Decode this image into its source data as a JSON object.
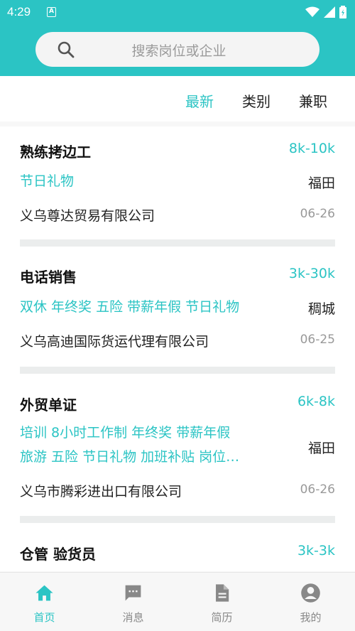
{
  "status_bar": {
    "time": "4:29",
    "notification": "A"
  },
  "search": {
    "placeholder": "搜索岗位或企业"
  },
  "filters": [
    {
      "label": "最新",
      "active": true
    },
    {
      "label": "类别",
      "active": false
    },
    {
      "label": "兼职",
      "active": false
    }
  ],
  "jobs": [
    {
      "title": "熟练拷边工",
      "salary": "8k-10k",
      "tags": "节日礼物",
      "location": "福田",
      "company": "义乌尊达贸易有限公司",
      "date": "06-26"
    },
    {
      "title": "电话销售",
      "salary": "3k-30k",
      "tags": "双休 年终奖 五险 带薪年假 节日礼物",
      "location": "稠城",
      "company": "义乌高迪国际货运代理有限公司",
      "date": "06-25"
    },
    {
      "title": "外贸单证",
      "salary": "6k-8k",
      "tags_line1": "培训 8小时工作制 年终奖 带薪年假",
      "tags_line2": "旅游 五险 节日礼物 加班补贴 岗位…",
      "location": "福田",
      "company": "义乌市腾彩进出口有限公司",
      "date": "06-26"
    },
    {
      "title": "仓管 验货员",
      "salary": "3k-3k"
    }
  ],
  "bottom_nav": [
    {
      "label": "首页",
      "icon": "home-icon",
      "active": true
    },
    {
      "label": "消息",
      "icon": "message-icon",
      "active": false
    },
    {
      "label": "简历",
      "icon": "resume-icon",
      "active": false
    },
    {
      "label": "我的",
      "icon": "profile-icon",
      "active": false
    }
  ],
  "colors": {
    "accent": "#2bc4c4",
    "inactive": "#888888",
    "divider": "#ebeded"
  }
}
